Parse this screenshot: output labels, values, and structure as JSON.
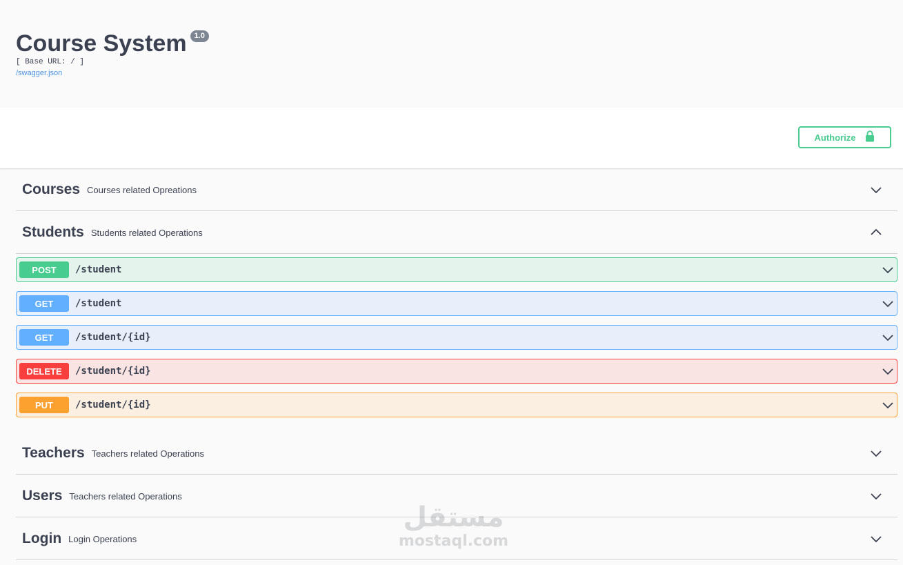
{
  "info": {
    "title": "Course System",
    "version": "1.0",
    "base_url": "[ Base URL: / ]",
    "spec_link": "/swagger.json"
  },
  "auth": {
    "authorize_label": "Authorize",
    "icon": "lock-icon"
  },
  "colors": {
    "post": "#49cc90",
    "get": "#61affe",
    "delete": "#f93e3e",
    "put": "#fca130",
    "link": "#4990e2"
  },
  "tags": [
    {
      "name": "Courses",
      "description": "Courses related Opreations",
      "expanded": false
    },
    {
      "name": "Students",
      "description": "Students related Operations",
      "expanded": true,
      "operations": [
        {
          "method": "POST",
          "path": "/student"
        },
        {
          "method": "GET",
          "path": "/student"
        },
        {
          "method": "GET",
          "path": "/student/{id}"
        },
        {
          "method": "DELETE",
          "path": "/student/{id}"
        },
        {
          "method": "PUT",
          "path": "/student/{id}"
        }
      ]
    },
    {
      "name": "Teachers",
      "description": "Teachers related Operations",
      "expanded": false
    },
    {
      "name": "Users",
      "description": "Teachers related Operations",
      "expanded": false
    },
    {
      "name": "Login",
      "description": "Login Operations",
      "expanded": false
    }
  ],
  "watermark": {
    "arabic": "مستقل",
    "latin": "mostaql.com"
  }
}
